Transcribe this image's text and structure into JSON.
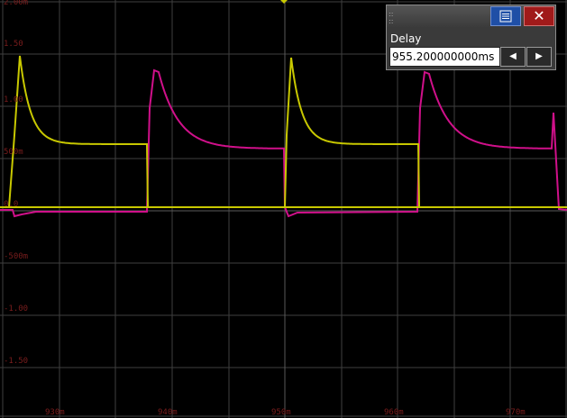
{
  "scope": {
    "y_axis_labels": [
      "2.00m",
      "1.50",
      "1.00",
      "500m",
      "0.0",
      "-500m",
      "-1.00",
      "-1.50"
    ],
    "x_axis_labels": [
      "930m",
      "940m",
      "950m",
      "960m",
      "970m"
    ],
    "colors": {
      "background": "#000000",
      "grid": "#3f3f3f",
      "ch1": "#c8c800",
      "ch2": "#d0108a",
      "axis_label": "#7a1d1d"
    }
  },
  "delay_panel": {
    "drag_icon": "grip-dots-icon",
    "menu_icon": "menu-list-icon",
    "close_icon": "close-icon",
    "close_glyph": "✕",
    "label": "Delay",
    "value": "955.200000000ms",
    "decrement_glyph": "◀",
    "increment_glyph": "▶"
  }
}
